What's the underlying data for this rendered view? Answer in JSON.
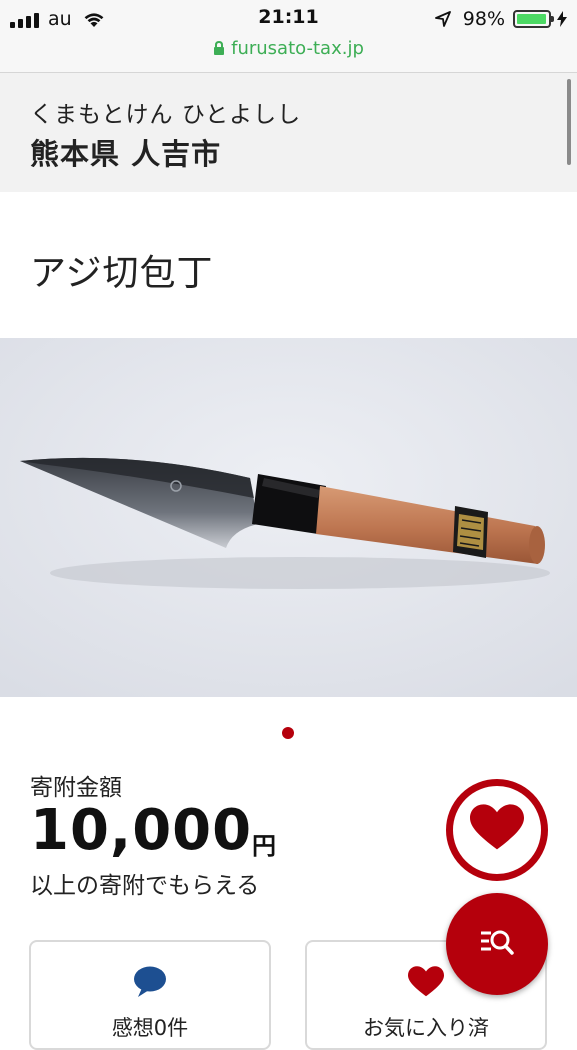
{
  "status_bar": {
    "carrier": "au",
    "time": "21:11",
    "battery_percent": "98%",
    "battery_level": 0.98,
    "url": "furusato-tax.jp"
  },
  "header": {
    "kana": "くまもとけん ひとよしし",
    "city": "熊本県 人吉市"
  },
  "product": {
    "title": "アジ切包丁",
    "image": "knife-photo"
  },
  "carousel": {
    "current": 1,
    "total": 1
  },
  "donation": {
    "label": "寄附金額",
    "amount": "10,000",
    "unit": "円",
    "note": "以上の寄附でもらえる"
  },
  "cards": {
    "reviews_label": "感想0件",
    "favorite_label": "お気に入り済"
  },
  "colors": {
    "accent": "#b5000c",
    "url_green": "#3dae55",
    "comment_blue": "#1d4f91"
  }
}
